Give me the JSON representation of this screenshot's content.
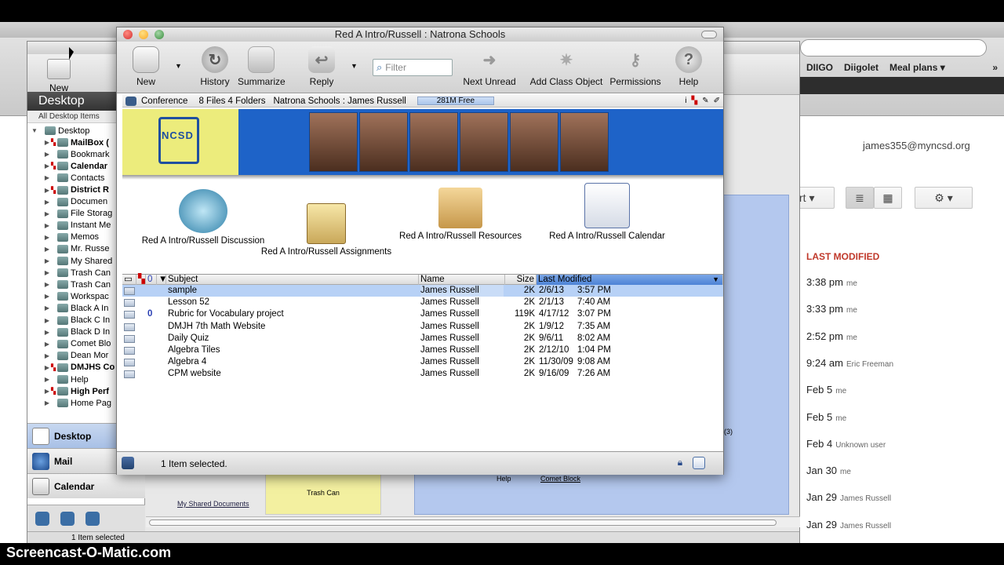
{
  "window": {
    "title": "Red A Intro/Russell : Natrona Schools"
  },
  "toolbar": {
    "new": "New",
    "history": "History",
    "summarize": "Summarize",
    "reply": "Reply",
    "filter_placeholder": "Filter",
    "next_unread": "Next Unread",
    "add_class_object": "Add Class Object",
    "permissions": "Permissions",
    "help": "Help"
  },
  "info": {
    "type": "Conference",
    "counts": "8 Files 4 Folders",
    "location": "Natrona Schools : James Russell",
    "free": "281M Free"
  },
  "banner": {
    "logo_text": "NCSD"
  },
  "tiles": [
    {
      "label": "Red A Intro/Russell Discussion",
      "icon": "discussion-icon"
    },
    {
      "label": "Red A Intro/Russell Assignments",
      "icon": "assignments-icon"
    },
    {
      "label": "Red A Intro/Russell Resources",
      "icon": "folder-icon"
    },
    {
      "label": "Red A Intro/Russell Calendar",
      "icon": "calendar-icon"
    }
  ],
  "list": {
    "headers": {
      "subject": "Subject",
      "name": "Name",
      "size": "Size",
      "modified": "Last Modified"
    },
    "rows": [
      {
        "subject": "sample",
        "name": "James Russell",
        "size": "2K",
        "date": "2/6/13",
        "time": "3:57 PM",
        "attach": false
      },
      {
        "subject": "Lesson 52",
        "name": "James Russell",
        "size": "2K",
        "date": "2/1/13",
        "time": "7:40 AM",
        "attach": false
      },
      {
        "subject": "Rubric for Vocabulary project",
        "name": "James Russell",
        "size": "119K",
        "date": "4/17/12",
        "time": "3:07 PM",
        "attach": true
      },
      {
        "subject": "DMJH 7th Math Website",
        "name": "James Russell",
        "size": "2K",
        "date": "1/9/12",
        "time": "7:35 AM",
        "attach": false
      },
      {
        "subject": "Daily Quiz",
        "name": "James Russell",
        "size": "2K",
        "date": "9/6/11",
        "time": "8:02 AM",
        "attach": false
      },
      {
        "subject": "Algebra Tiles",
        "name": "James Russell",
        "size": "2K",
        "date": "2/12/10",
        "time": "1:04 PM",
        "attach": false
      },
      {
        "subject": "Algebra 4",
        "name": "James Russell",
        "size": "2K",
        "date": "11/30/09",
        "time": "9:08 AM",
        "attach": false
      },
      {
        "subject": "CPM website",
        "name": "James Russell",
        "size": "2K",
        "date": "9/16/09",
        "time": "7:26 AM",
        "attach": false
      }
    ]
  },
  "status": {
    "selection": "1 Item selected."
  },
  "desktop": {
    "new": "New",
    "header": "Desktop",
    "sub": "All Desktop Items",
    "tree": [
      {
        "label": "Desktop",
        "bold": false,
        "flag": false
      },
      {
        "label": "MailBox (",
        "bold": true,
        "flag": true
      },
      {
        "label": "Bookmark",
        "bold": false,
        "flag": false
      },
      {
        "label": "Calendar",
        "bold": true,
        "flag": true
      },
      {
        "label": "Contacts",
        "bold": false,
        "flag": false
      },
      {
        "label": "District R",
        "bold": true,
        "flag": true
      },
      {
        "label": "Documen",
        "bold": false,
        "flag": false
      },
      {
        "label": "File Storag",
        "bold": false,
        "flag": false
      },
      {
        "label": "Instant Me",
        "bold": false,
        "flag": false
      },
      {
        "label": "Memos",
        "bold": false,
        "flag": false
      },
      {
        "label": "Mr. Russe",
        "bold": false,
        "flag": false
      },
      {
        "label": "My Shared",
        "bold": false,
        "flag": false
      },
      {
        "label": "Trash Can",
        "bold": false,
        "flag": false
      },
      {
        "label": "Trash Can",
        "bold": false,
        "flag": false
      },
      {
        "label": "Workspac",
        "bold": false,
        "flag": false
      },
      {
        "label": "Black A In",
        "bold": false,
        "flag": false
      },
      {
        "label": "Black C In",
        "bold": false,
        "flag": false
      },
      {
        "label": "Black D In",
        "bold": false,
        "flag": false
      },
      {
        "label": "Comet Blo",
        "bold": false,
        "flag": false
      },
      {
        "label": "Dean Mor",
        "bold": false,
        "flag": false
      },
      {
        "label": "DMJHS Co",
        "bold": true,
        "flag": true
      },
      {
        "label": "Help",
        "bold": false,
        "flag": false
      },
      {
        "label": "High Perf",
        "bold": true,
        "flag": true
      },
      {
        "label": "Home Pag",
        "bold": false,
        "flag": false
      }
    ],
    "nav": {
      "desktop": "Desktop",
      "mail": "Mail",
      "calendar": "Calendar"
    },
    "status": "1 Item selected",
    "shared_docs": "My Shared Documents",
    "trash": "Trash Can",
    "help": "Help",
    "comet": "Comet Block",
    "count": "(3)"
  },
  "browser": {
    "bookmarks": [
      "DIIGO",
      "Diigolet",
      "Meal plans ▾"
    ],
    "account": "james355@myncsd.org",
    "sort_partial": "rt",
    "last_modified_title": "LAST MODIFIED",
    "modified": [
      {
        "when": "3:38 pm",
        "who": "me"
      },
      {
        "when": "3:33 pm",
        "who": "me"
      },
      {
        "when": "2:52 pm",
        "who": "me"
      },
      {
        "when": "9:24 am",
        "who": "Eric Freeman"
      },
      {
        "when": "Feb 5",
        "who": "me"
      },
      {
        "when": "Feb 5",
        "who": "me"
      },
      {
        "when": "Feb 4",
        "who": "Unknown user"
      },
      {
        "when": "Jan 30",
        "who": "me"
      },
      {
        "when": "Jan 29",
        "who": "James Russell"
      },
      {
        "when": "Jan 29",
        "who": "James Russell"
      }
    ]
  },
  "watermark": "Screencast-O-Matic.com"
}
